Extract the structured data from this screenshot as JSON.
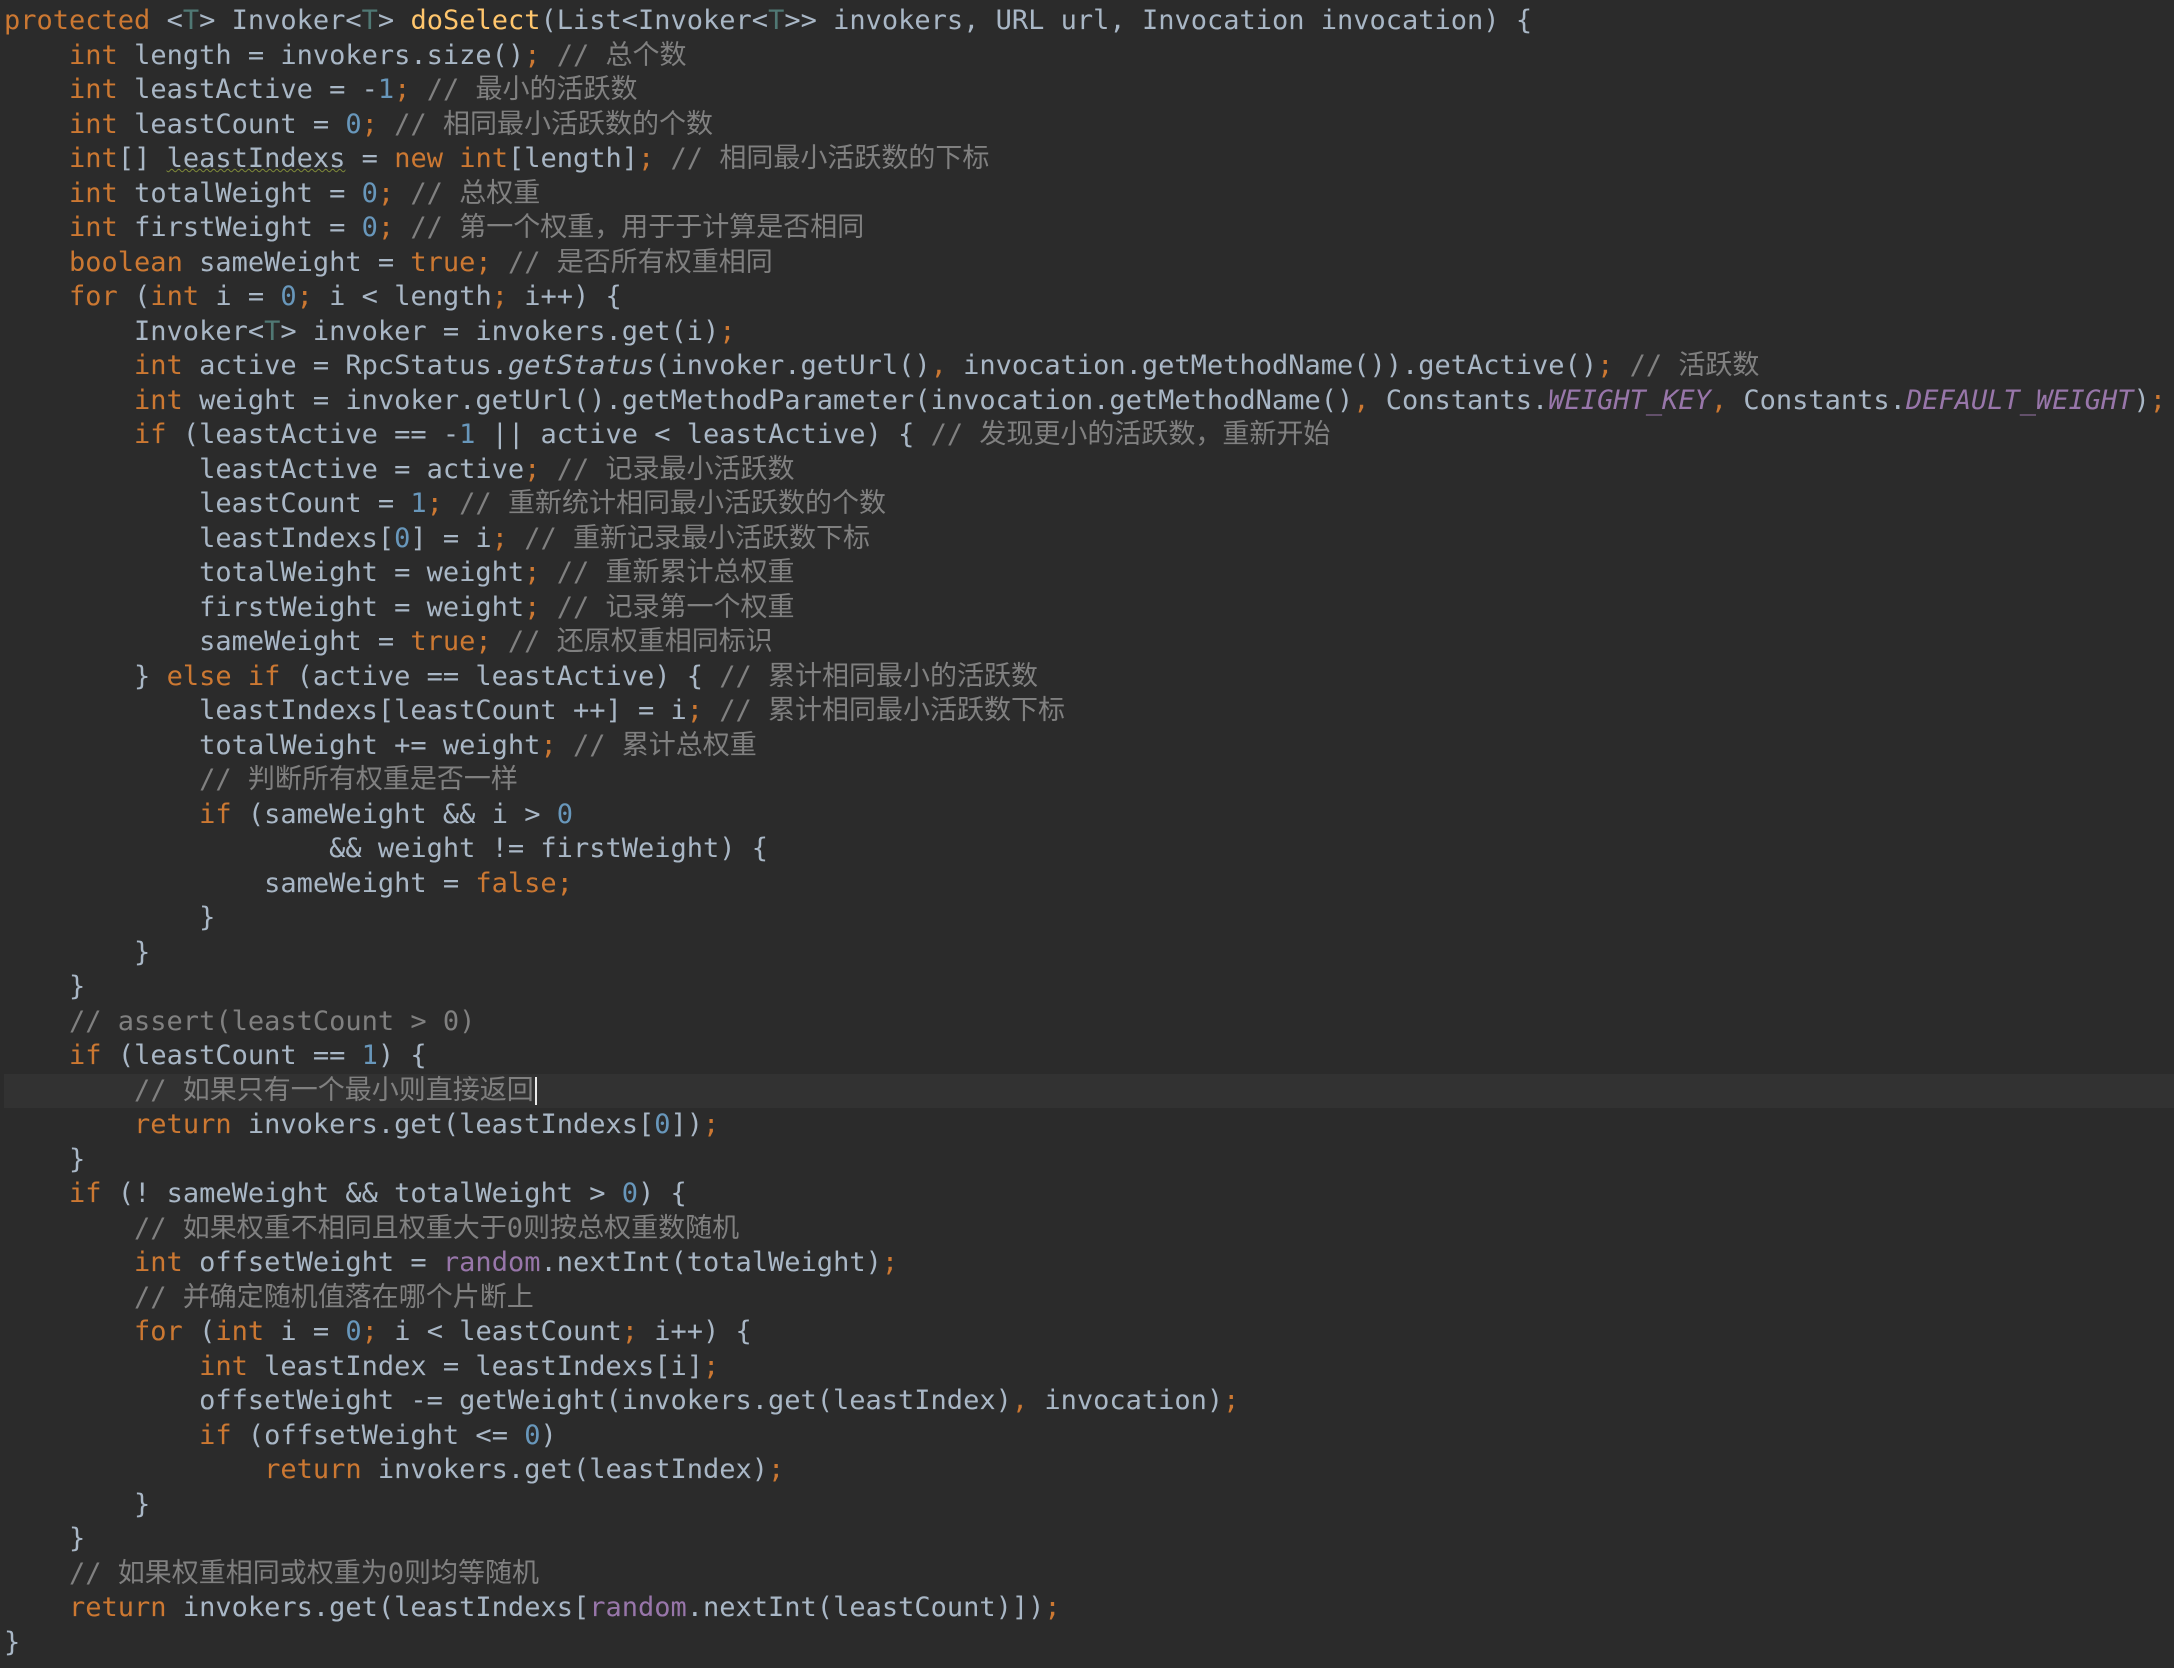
{
  "editor": {
    "colors": {
      "background": "#2b2b2b",
      "current_line": "#323232",
      "plain": "#a9b7c6",
      "keyword": "#cc7832",
      "number": "#6897bb",
      "comment": "#808080",
      "method_declaration": "#ffc66d",
      "type_parameter": "#507874",
      "field": "#9876aa"
    },
    "caret_line": 31,
    "lines": [
      [
        [
          "k",
          "protected "
        ],
        [
          "p",
          "<"
        ],
        [
          "g",
          "T"
        ],
        [
          "p",
          "> Invoker<"
        ],
        [
          "g",
          "T"
        ],
        [
          "p",
          "> "
        ],
        [
          "f",
          "doSelect"
        ],
        [
          "p",
          "(List<Invoker<"
        ],
        [
          "g",
          "T"
        ],
        [
          "p",
          ">> invokers, URL url, Invocation invocation) {"
        ]
      ],
      [
        [
          "p",
          "    "
        ],
        [
          "k",
          "int "
        ],
        [
          "p",
          "length = invokers.size()"
        ],
        [
          "k",
          ";"
        ],
        [
          "c",
          " // 总个数"
        ]
      ],
      [
        [
          "p",
          "    "
        ],
        [
          "k",
          "int "
        ],
        [
          "p",
          "leastActive = -"
        ],
        [
          "n",
          "1"
        ],
        [
          "k",
          ";"
        ],
        [
          "c",
          " // 最小的活跃数"
        ]
      ],
      [
        [
          "p",
          "    "
        ],
        [
          "k",
          "int "
        ],
        [
          "p",
          "leastCount = "
        ],
        [
          "n",
          "0"
        ],
        [
          "k",
          ";"
        ],
        [
          "c",
          " // 相同最小活跃数的个数"
        ]
      ],
      [
        [
          "p",
          "    "
        ],
        [
          "k",
          "int"
        ],
        [
          "p",
          "[] "
        ],
        [
          "w",
          "leastIndexs"
        ],
        [
          "p",
          " = "
        ],
        [
          "k",
          "new int"
        ],
        [
          "p",
          "[length]"
        ],
        [
          "k",
          ";"
        ],
        [
          "c",
          " // 相同最小活跃数的下标"
        ]
      ],
      [
        [
          "p",
          "    "
        ],
        [
          "k",
          "int "
        ],
        [
          "p",
          "totalWeight = "
        ],
        [
          "n",
          "0"
        ],
        [
          "k",
          ";"
        ],
        [
          "c",
          " // 总权重"
        ]
      ],
      [
        [
          "p",
          "    "
        ],
        [
          "k",
          "int "
        ],
        [
          "p",
          "firstWeight = "
        ],
        [
          "n",
          "0"
        ],
        [
          "k",
          ";"
        ],
        [
          "c",
          " // 第一个权重，用于于计算是否相同"
        ]
      ],
      [
        [
          "p",
          "    "
        ],
        [
          "k",
          "boolean "
        ],
        [
          "p",
          "sameWeight = "
        ],
        [
          "k",
          "true;"
        ],
        [
          "c",
          " // 是否所有权重相同"
        ]
      ],
      [
        [
          "p",
          "    "
        ],
        [
          "k",
          "for "
        ],
        [
          "p",
          "("
        ],
        [
          "k",
          "int "
        ],
        [
          "p",
          "i = "
        ],
        [
          "n",
          "0"
        ],
        [
          "k",
          "; "
        ],
        [
          "p",
          "i < length"
        ],
        [
          "k",
          "; "
        ],
        [
          "p",
          "i++) {"
        ]
      ],
      [
        [
          "p",
          "        Invoker<"
        ],
        [
          "g",
          "T"
        ],
        [
          "p",
          "> invoker = invokers.get(i)"
        ],
        [
          "k",
          ";"
        ]
      ],
      [
        [
          "p",
          "        "
        ],
        [
          "k",
          "int "
        ],
        [
          "p",
          "active = RpcStatus."
        ],
        [
          "i",
          "getStatus"
        ],
        [
          "p",
          "(invoker.getUrl()"
        ],
        [
          "k",
          ", "
        ],
        [
          "p",
          "invocation.getMethodName()).getActive()"
        ],
        [
          "k",
          ";"
        ],
        [
          "c",
          " // 活跃数"
        ]
      ],
      [
        [
          "p",
          "        "
        ],
        [
          "k",
          "int "
        ],
        [
          "p",
          "weight = invoker.getUrl().getMethodParameter(invocation.getMethodName()"
        ],
        [
          "k",
          ", "
        ],
        [
          "p",
          "Constants."
        ],
        [
          "si",
          "WEIGHT_KEY"
        ],
        [
          "k",
          ", "
        ],
        [
          "p",
          "Constants."
        ],
        [
          "si",
          "DEFAULT_WEIGHT"
        ],
        [
          "p",
          ")"
        ],
        [
          "k",
          ";"
        ],
        [
          "c",
          " // 权重"
        ]
      ],
      [
        [
          "p",
          "        "
        ],
        [
          "k",
          "if "
        ],
        [
          "p",
          "(leastActive == -"
        ],
        [
          "n",
          "1 "
        ],
        [
          "p",
          "|| active < leastActive) {"
        ],
        [
          "c",
          " // 发现更小的活跃数，重新开始"
        ]
      ],
      [
        [
          "p",
          "            leastActive = active"
        ],
        [
          "k",
          ";"
        ],
        [
          "c",
          " // 记录最小活跃数"
        ]
      ],
      [
        [
          "p",
          "            leastCount = "
        ],
        [
          "n",
          "1"
        ],
        [
          "k",
          ";"
        ],
        [
          "c",
          " // 重新统计相同最小活跃数的个数"
        ]
      ],
      [
        [
          "p",
          "            leastIndexs["
        ],
        [
          "n",
          "0"
        ],
        [
          "p",
          "] = i"
        ],
        [
          "k",
          ";"
        ],
        [
          "c",
          " // 重新记录最小活跃数下标"
        ]
      ],
      [
        [
          "p",
          "            totalWeight = weight"
        ],
        [
          "k",
          ";"
        ],
        [
          "c",
          " // 重新累计总权重"
        ]
      ],
      [
        [
          "p",
          "            firstWeight = weight"
        ],
        [
          "k",
          ";"
        ],
        [
          "c",
          " // 记录第一个权重"
        ]
      ],
      [
        [
          "p",
          "            sameWeight = "
        ],
        [
          "k",
          "true;"
        ],
        [
          "c",
          " // 还原权重相同标识"
        ]
      ],
      [
        [
          "p",
          "        } "
        ],
        [
          "k",
          "else if "
        ],
        [
          "p",
          "(active == leastActive) {"
        ],
        [
          "c",
          " // 累计相同最小的活跃数"
        ]
      ],
      [
        [
          "p",
          "            leastIndexs[leastCount ++] = i"
        ],
        [
          "k",
          ";"
        ],
        [
          "c",
          " // 累计相同最小活跃数下标"
        ]
      ],
      [
        [
          "p",
          "            totalWeight += weight"
        ],
        [
          "k",
          ";"
        ],
        [
          "c",
          " // 累计总权重"
        ]
      ],
      [
        [
          "c",
          "            // 判断所有权重是否一样"
        ]
      ],
      [
        [
          "p",
          "            "
        ],
        [
          "k",
          "if "
        ],
        [
          "p",
          "(sameWeight && i > "
        ],
        [
          "n",
          "0"
        ]
      ],
      [
        [
          "p",
          "                    && weight != firstWeight) {"
        ]
      ],
      [
        [
          "p",
          "                sameWeight = "
        ],
        [
          "k",
          "false;"
        ]
      ],
      [
        [
          "p",
          "            }"
        ]
      ],
      [
        [
          "p",
          "        }"
        ]
      ],
      [
        [
          "p",
          "    }"
        ]
      ],
      [
        [
          "c",
          "    // assert(leastCount > 0)"
        ]
      ],
      [
        [
          "p",
          "    "
        ],
        [
          "k",
          "if "
        ],
        [
          "p",
          "(leastCount == "
        ],
        [
          "n",
          "1"
        ],
        [
          "p",
          ") {"
        ]
      ],
      [
        [
          "c",
          "        // 如果只有一个最小则直接返回"
        ]
      ],
      [
        [
          "p",
          "        "
        ],
        [
          "k",
          "return "
        ],
        [
          "p",
          "invokers.get(leastIndexs["
        ],
        [
          "n",
          "0"
        ],
        [
          "p",
          "])"
        ],
        [
          "k",
          ";"
        ]
      ],
      [
        [
          "p",
          "    }"
        ]
      ],
      [
        [
          "p",
          "    "
        ],
        [
          "k",
          "if "
        ],
        [
          "p",
          "(! sameWeight && totalWeight > "
        ],
        [
          "n",
          "0"
        ],
        [
          "p",
          ") {"
        ]
      ],
      [
        [
          "c",
          "        // 如果权重不相同且权重大于0则按总权重数随机"
        ]
      ],
      [
        [
          "p",
          "        "
        ],
        [
          "k",
          "int "
        ],
        [
          "p",
          "offsetWeight = "
        ],
        [
          "s",
          "random"
        ],
        [
          "p",
          ".nextInt(totalWeight)"
        ],
        [
          "k",
          ";"
        ]
      ],
      [
        [
          "c",
          "        // 并确定随机值落在哪个片断上"
        ]
      ],
      [
        [
          "p",
          "        "
        ],
        [
          "k",
          "for "
        ],
        [
          "p",
          "("
        ],
        [
          "k",
          "int "
        ],
        [
          "p",
          "i = "
        ],
        [
          "n",
          "0"
        ],
        [
          "k",
          "; "
        ],
        [
          "p",
          "i < leastCount"
        ],
        [
          "k",
          "; "
        ],
        [
          "p",
          "i++) {"
        ]
      ],
      [
        [
          "p",
          "            "
        ],
        [
          "k",
          "int "
        ],
        [
          "p",
          "leastIndex = leastIndexs[i]"
        ],
        [
          "k",
          ";"
        ]
      ],
      [
        [
          "p",
          "            offsetWeight -= getWeight(invokers.get(leastIndex)"
        ],
        [
          "k",
          ", "
        ],
        [
          "p",
          "invocation)"
        ],
        [
          "k",
          ";"
        ]
      ],
      [
        [
          "p",
          "            "
        ],
        [
          "k",
          "if "
        ],
        [
          "p",
          "(offsetWeight <= "
        ],
        [
          "n",
          "0"
        ],
        [
          "p",
          ")"
        ]
      ],
      [
        [
          "p",
          "                "
        ],
        [
          "k",
          "return "
        ],
        [
          "p",
          "invokers.get(leastIndex)"
        ],
        [
          "k",
          ";"
        ]
      ],
      [
        [
          "p",
          "        }"
        ]
      ],
      [
        [
          "p",
          "    }"
        ]
      ],
      [
        [
          "c",
          "    // 如果权重相同或权重为0则均等随机"
        ]
      ],
      [
        [
          "p",
          "    "
        ],
        [
          "k",
          "return "
        ],
        [
          "p",
          "invokers.get(leastIndexs["
        ],
        [
          "s",
          "random"
        ],
        [
          "p",
          ".nextInt(leastCount)])"
        ],
        [
          "k",
          ";"
        ]
      ],
      [
        [
          "p",
          "}"
        ]
      ]
    ]
  }
}
